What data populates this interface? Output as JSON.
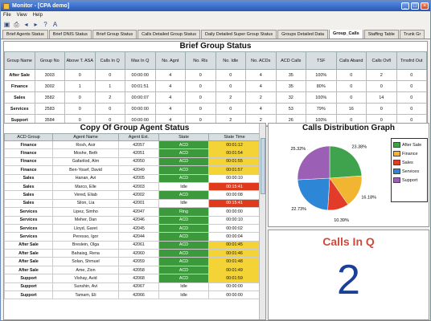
{
  "window": {
    "title": "Monitor - [CPA demo]",
    "min": "_",
    "max": "□",
    "close": "×"
  },
  "menu": [
    "File",
    "View",
    "Help"
  ],
  "toolbar_icons": [
    "save-icon",
    "print-icon",
    "back-icon",
    "forward-icon",
    "help-icon",
    "font-icon"
  ],
  "tabs": [
    "Brief Agents Status",
    "Brief DNIS Status",
    "Brief Group Status",
    "Calls Detailed Group Status",
    "Daily Detailed Super Group Status",
    "Groups Detailed Data",
    "Group_Calls",
    "Staffing Table",
    "Trunk Gr"
  ],
  "active_tab": 6,
  "brief": {
    "title": "Brief Group Status",
    "headers": [
      "Group Name",
      "Group No",
      "Above T. ASA",
      "Calls In Q",
      "Max In Q",
      "No. Agnt",
      "No. Rls",
      "No. Idle",
      "No. ACDs",
      "ACD Calls",
      "TSF",
      "Calls Aband",
      "Calls Ovfl",
      "Trnsfrd Out"
    ],
    "rows": [
      [
        "After Sale",
        "3003",
        "0",
        "0",
        "00:00:00",
        "4",
        "0",
        "0",
        "4",
        "35",
        "100%",
        "0",
        "2",
        "0"
      ],
      [
        "Finance",
        "3002",
        "1",
        "1",
        "00:01:51",
        "4",
        "0",
        "0",
        "4",
        "35",
        "80%",
        "0",
        "0",
        "0"
      ],
      [
        "Sales",
        "3582",
        "0",
        "2",
        "00:00:07",
        "4",
        "0",
        "2",
        "2",
        "32",
        "100%",
        "0",
        "14",
        "0"
      ],
      [
        "Services",
        "2583",
        "0",
        "0",
        "00:00:00",
        "4",
        "0",
        "0",
        "4",
        "53",
        "79%",
        "16",
        "0",
        "0"
      ],
      [
        "Support",
        "3584",
        "0",
        "0",
        "00:00:00",
        "4",
        "0",
        "2",
        "2",
        "26",
        "100%",
        "0",
        "0",
        "0"
      ]
    ]
  },
  "agents": {
    "title": "Copy Of Group Agent Status",
    "headers": [
      "ACD Group",
      "Agent Name",
      "Agent Ext.",
      "State",
      "State Time"
    ],
    "rows": [
      [
        "Finance",
        "Rosh, Asir",
        "42057",
        "ACD",
        "00:01:12",
        "acd",
        "yellow"
      ],
      [
        "Finance",
        "Moshe, Beth",
        "42051",
        "ACD",
        "00:01:54",
        "acd",
        "yellow"
      ],
      [
        "Finance",
        "Gafarilod, Alm",
        "42050",
        "ACD",
        "00:01:55",
        "acd",
        "yellow"
      ],
      [
        "Finance",
        "Ben-Yosef, David",
        "42049",
        "ACD",
        "00:01:57",
        "acd",
        "yellow"
      ],
      [
        "Sales",
        "Hanan, Avi",
        "42005",
        "ACD",
        "00:00:10",
        "acd",
        "none"
      ],
      [
        "Sales",
        "Marco, Elle",
        "42003",
        "Idle",
        "00:15:41",
        "idle",
        "red"
      ],
      [
        "Sales",
        "Vered, Eliab",
        "42002",
        "ACD",
        "00:00:08",
        "acd",
        "none"
      ],
      [
        "Sales",
        "Silon, Lia",
        "42001",
        "Idle",
        "00:15:41",
        "idle",
        "red"
      ],
      [
        "Services",
        "Lipez, Simho",
        "42047",
        "Ring",
        "00:00:00",
        "ring",
        "none"
      ],
      [
        "Services",
        "Meher, Dan",
        "42046",
        "ACD",
        "00:00:10",
        "acd",
        "none"
      ],
      [
        "Services",
        "Lloyd, Garet",
        "42045",
        "ACD",
        "00:00:02",
        "acd",
        "none"
      ],
      [
        "Services",
        "Peresso, Igor",
        "42044",
        "ACD",
        "00:00:04",
        "acd",
        "none"
      ],
      [
        "After Sale",
        "Breslein, Olga",
        "42061",
        "ACD",
        "00:01:45",
        "acd",
        "yellow"
      ],
      [
        "After Sale",
        "Bahaisg, Rena",
        "42060",
        "ACD",
        "00:01:46",
        "acd",
        "yellow"
      ],
      [
        "After Sale",
        "Solan, Shmuel",
        "42059",
        "ACD",
        "00:01:48",
        "acd",
        "yellow"
      ],
      [
        "After Sale",
        "Ame, Zion",
        "42058",
        "ACD",
        "00:01:49",
        "acd",
        "yellow"
      ],
      [
        "Support",
        "Vishay, Avid",
        "42068",
        "ACD",
        "00:01:59",
        "acd",
        "yellow"
      ],
      [
        "Support",
        "Sunshin, Avi",
        "42067",
        "Idle",
        "00:00:00",
        "idle",
        "none"
      ],
      [
        "Support",
        "Tamam, Eli",
        "42066",
        "Idle",
        "00:00:00",
        "idle",
        "none"
      ]
    ]
  },
  "chart_data": {
    "type": "pie",
    "title": "Calls Distribution Graph",
    "categories": [
      "After Sale",
      "Finance",
      "Sales",
      "Services",
      "Support"
    ],
    "values": [
      23.38,
      16.18,
      10.39,
      22.73,
      25.32
    ],
    "labels": [
      "23.38%",
      "16.18%",
      "10.39%",
      "22.73%",
      "25.32%"
    ],
    "colors": [
      "#3fa34d",
      "#f2b531",
      "#e23b2a",
      "#2d86d6",
      "#9b5fb5"
    ],
    "legend_position": "right"
  },
  "callsq": {
    "title": "Calls In Q",
    "value": "2"
  }
}
